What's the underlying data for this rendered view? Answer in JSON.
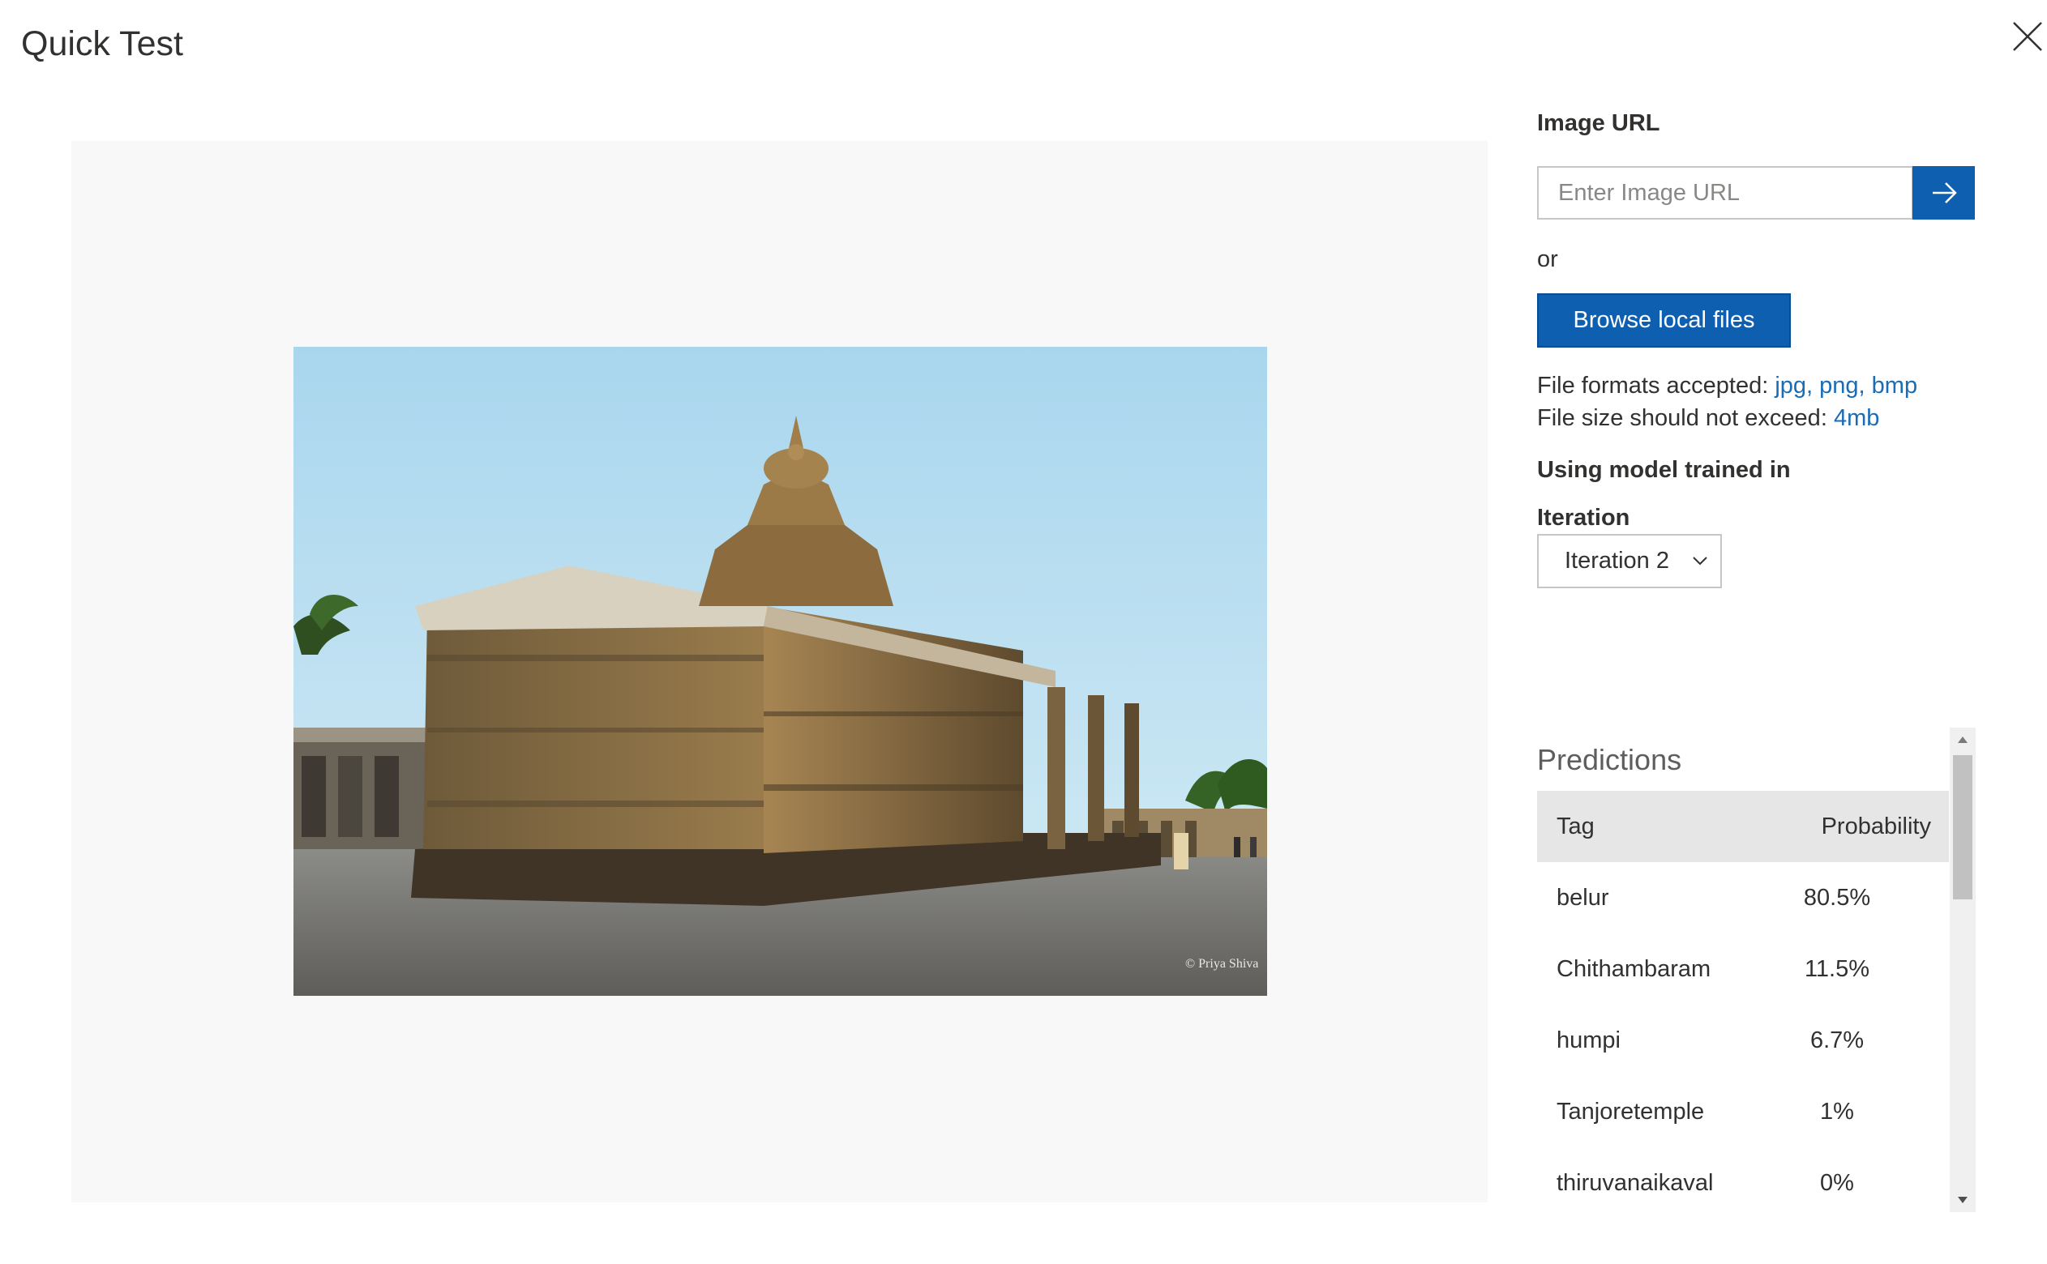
{
  "dialog": {
    "title": "Quick Test"
  },
  "image_url": {
    "label": "Image URL",
    "placeholder": "Enter Image URL",
    "value": ""
  },
  "or_text": "or",
  "browse_button": "Browse local files",
  "file_formats": {
    "prefix": "File formats accepted: ",
    "value": "jpg, png, bmp"
  },
  "file_size": {
    "prefix": "File size should not exceed: ",
    "value": "4mb"
  },
  "model": {
    "label": "Using model trained in",
    "iteration_label": "Iteration",
    "selected_iteration": "Iteration 2"
  },
  "predictions": {
    "heading": "Predictions",
    "columns": {
      "tag": "Tag",
      "probability": "Probability"
    },
    "rows": [
      {
        "tag": "belur",
        "probability": "80.5%"
      },
      {
        "tag": "Chithambaram",
        "probability": "11.5%"
      },
      {
        "tag": "humpi",
        "probability": "6.7%"
      },
      {
        "tag": "Tanjoretemple",
        "probability": "1%"
      },
      {
        "tag": "thiruvanaikaval",
        "probability": "0%"
      }
    ]
  },
  "preview": {
    "watermark": "© Priya Shiva"
  },
  "colors": {
    "primary": "#0f5fb0",
    "link": "#1a6cb5",
    "preview_bg": "#f8f8f8",
    "table_header_bg": "#e6e6e6"
  }
}
